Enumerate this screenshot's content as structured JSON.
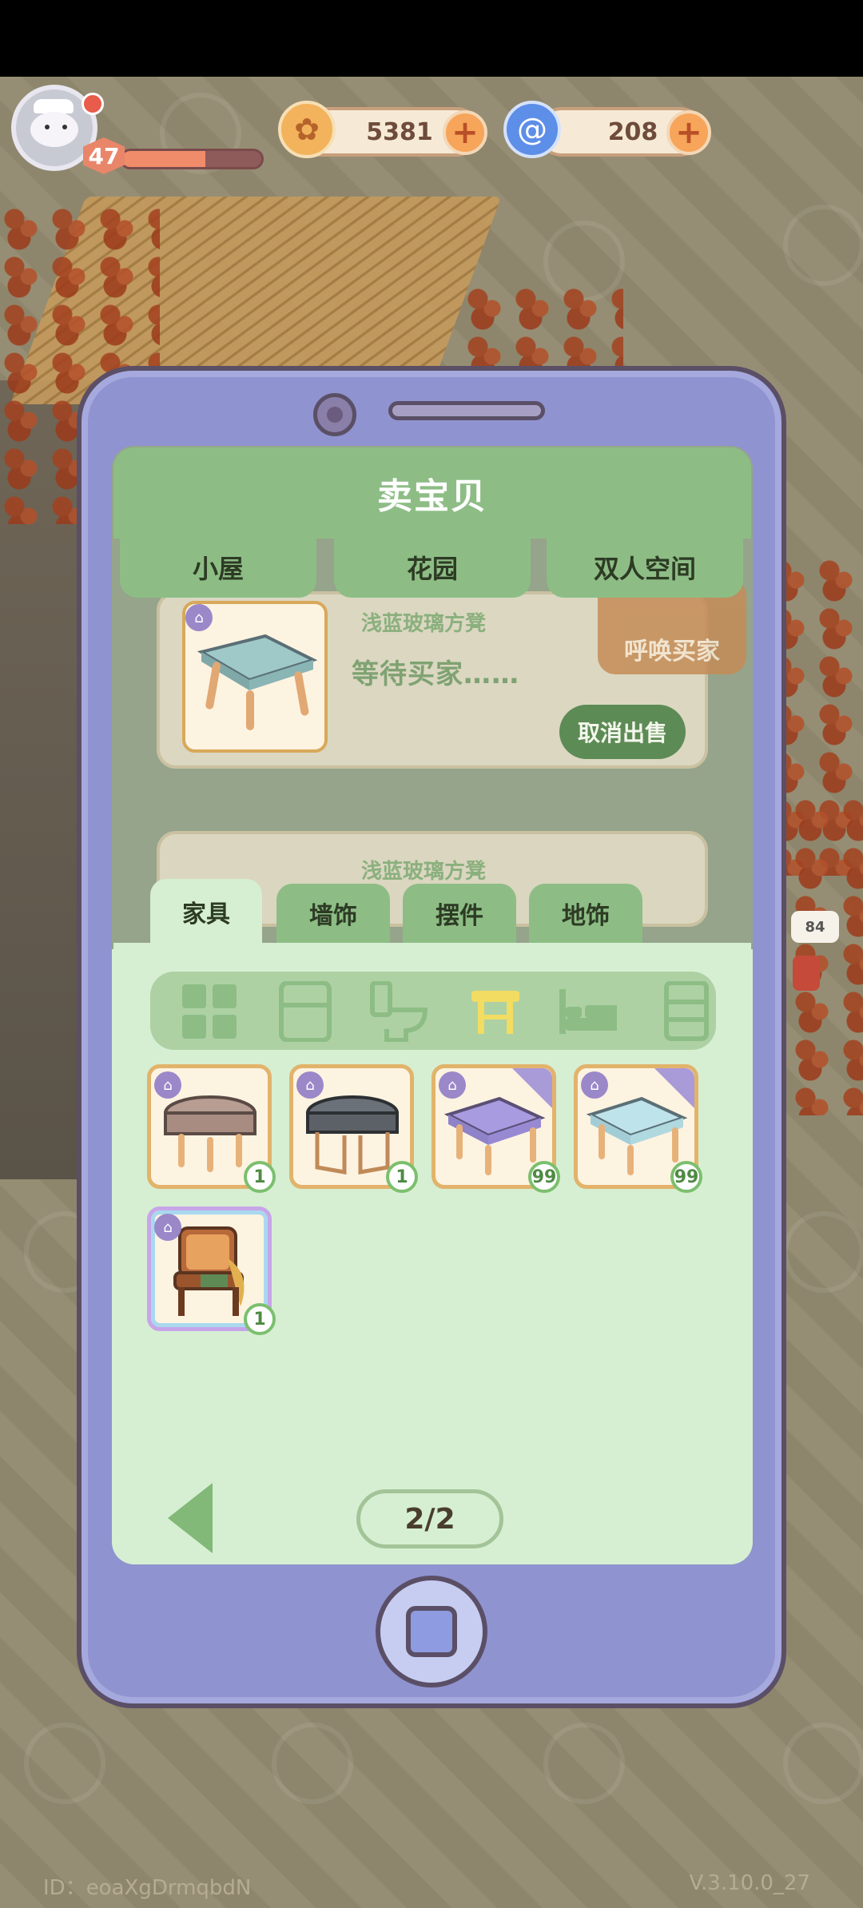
{
  "hud": {
    "level": "47",
    "level_progress": 0.6,
    "coins": "5381",
    "gems": "208"
  },
  "panel": {
    "title": "卖宝贝",
    "tabs": [
      "小屋",
      "花园",
      "双人空间"
    ],
    "selling": [
      {
        "name": "浅蓝玻璃方凳",
        "status": "等待买家……",
        "cancel_label": "取消出售"
      },
      {
        "name": "浅蓝玻璃方凳"
      }
    ],
    "summon_label": "呼唤买家"
  },
  "inventory": {
    "categories": [
      "家具",
      "墙饰",
      "摆件",
      "地饰"
    ],
    "active_category": "家具",
    "subcategory_icons": [
      "grid-icon",
      "fridge-icon",
      "toilet-icon",
      "stool-icon",
      "bed-icon",
      "cabinet-icon"
    ],
    "active_subcategory": "stool-icon",
    "items": [
      {
        "name": "brown-stool",
        "count": "1"
      },
      {
        "name": "gray-metal-stool",
        "count": "1"
      },
      {
        "name": "purple-glass-stool",
        "count": "99"
      },
      {
        "name": "light-blue-glass-stool",
        "count": "99"
      },
      {
        "name": "wooden-armchair",
        "count": "1"
      }
    ],
    "page": "2/2"
  },
  "world": {
    "mailbox_count": "84"
  },
  "footer": {
    "id_text": "ID：eoaXgDrmqbdN",
    "version": "V.3.10.0_27"
  },
  "colors": {
    "panel_green": "#8dbd85",
    "panel_bg": "#d6efd2",
    "phone_body": "#8f93cf",
    "coin": "#e9a24f",
    "gem": "#4d7fe0"
  }
}
